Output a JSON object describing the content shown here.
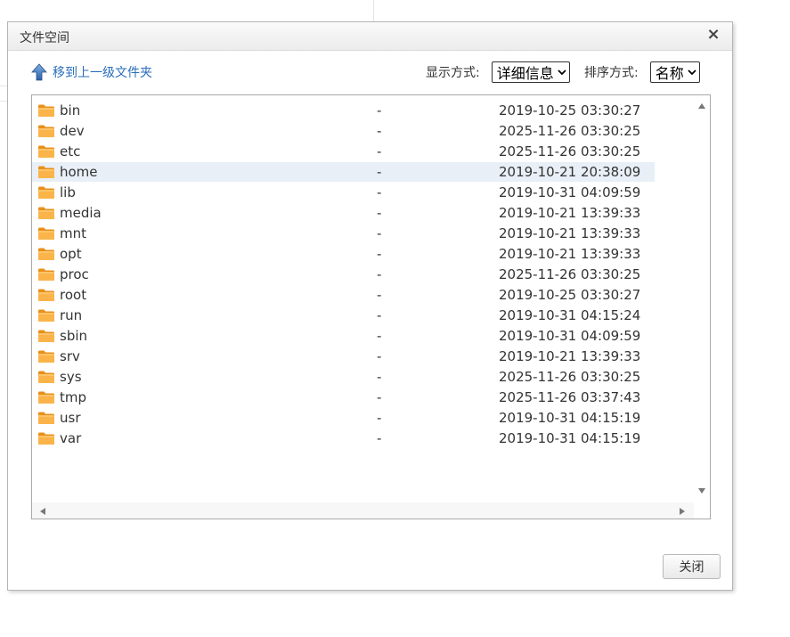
{
  "dialog": {
    "title": "文件空间",
    "close_glyph": "×",
    "up_label": "移到上一级文件夹",
    "display_label": "显示方式:",
    "display_value": "详细信息",
    "sort_label": "排序方式:",
    "sort_value": "名称",
    "close_button": "关闭"
  },
  "colors": {
    "link": "#2a6ebb",
    "folder": "#f5a623",
    "selected_row": "#e8eff7"
  },
  "files": [
    {
      "name": "bin",
      "size": "-",
      "date": "2019-10-25 03:30:27"
    },
    {
      "name": "dev",
      "size": "-",
      "date": "2025-11-26 03:30:25"
    },
    {
      "name": "etc",
      "size": "-",
      "date": "2025-11-26 03:30:25"
    },
    {
      "name": "home",
      "size": "-",
      "date": "2019-10-21 20:38:09",
      "selected": true
    },
    {
      "name": "lib",
      "size": "-",
      "date": "2019-10-31 04:09:59"
    },
    {
      "name": "media",
      "size": "-",
      "date": "2019-10-21 13:39:33"
    },
    {
      "name": "mnt",
      "size": "-",
      "date": "2019-10-21 13:39:33"
    },
    {
      "name": "opt",
      "size": "-",
      "date": "2019-10-21 13:39:33"
    },
    {
      "name": "proc",
      "size": "-",
      "date": "2025-11-26 03:30:25"
    },
    {
      "name": "root",
      "size": "-",
      "date": "2019-10-25 03:30:27"
    },
    {
      "name": "run",
      "size": "-",
      "date": "2019-10-31 04:15:24"
    },
    {
      "name": "sbin",
      "size": "-",
      "date": "2019-10-31 04:09:59"
    },
    {
      "name": "srv",
      "size": "-",
      "date": "2019-10-21 13:39:33"
    },
    {
      "name": "sys",
      "size": "-",
      "date": "2025-11-26 03:30:25"
    },
    {
      "name": "tmp",
      "size": "-",
      "date": "2025-11-26 03:37:43"
    },
    {
      "name": "usr",
      "size": "-",
      "date": "2019-10-31 04:15:19"
    },
    {
      "name": "var",
      "size": "-",
      "date": "2019-10-31 04:15:19"
    }
  ]
}
